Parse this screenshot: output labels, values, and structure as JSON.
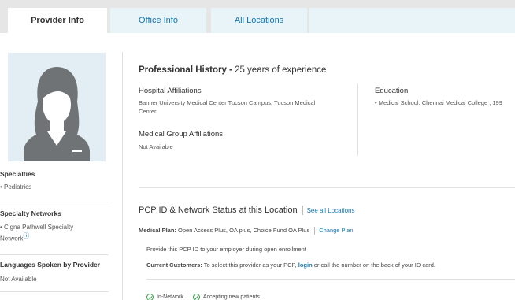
{
  "tabs": [
    {
      "label": "Provider Info"
    },
    {
      "label": "Office Info"
    },
    {
      "label": "All Locations"
    }
  ],
  "sidebar": {
    "specialties": {
      "heading": "Specialties",
      "value": "• Pediatrics"
    },
    "networks": {
      "heading": "Specialty Networks",
      "value": "• Cigna Pathwell Specialty Network",
      "badge": "ⓘ"
    },
    "languages": {
      "heading": "Languages Spoken by Provider",
      "value": "Not Available"
    }
  },
  "history": {
    "title": "Professional History - ",
    "experience": "25 years of experience",
    "hospital_heading": "Hospital Affiliations",
    "hospital_line1": "Banner University Medical Center Tucson Campus, Tucson Medical",
    "hospital_line2": "Center",
    "group_heading": "Medical Group Affiliations",
    "group_value": "Not Available",
    "education_heading": "Education",
    "education_value": "• Medical School: Chennai Medical College , 199"
  },
  "pcp": {
    "title": "PCP ID & Network Status at this Location",
    "see_all": "See all Locations",
    "plan_label": "Medical Plan:",
    "plan_value": "Open Access Plus, OA plus, Choice Fund OA Plus",
    "change_plan": "Change Plan",
    "provide_text": "Provide this PCP ID to your employer during open enrollment",
    "customers_label": "Current Customers:",
    "customers_text_a": "To select this provider as your PCP,",
    "login": "login",
    "customers_text_b": "or call the number on the back of your ID card.",
    "status_in_network": "In-Network",
    "status_accepting": "Accepting new patients"
  },
  "colors": {
    "accent": "#1a75a8",
    "tab_inactive_bg": "#e9f4f8",
    "avatar_bg": "#e3eef4",
    "check": "#3a9a4a"
  }
}
